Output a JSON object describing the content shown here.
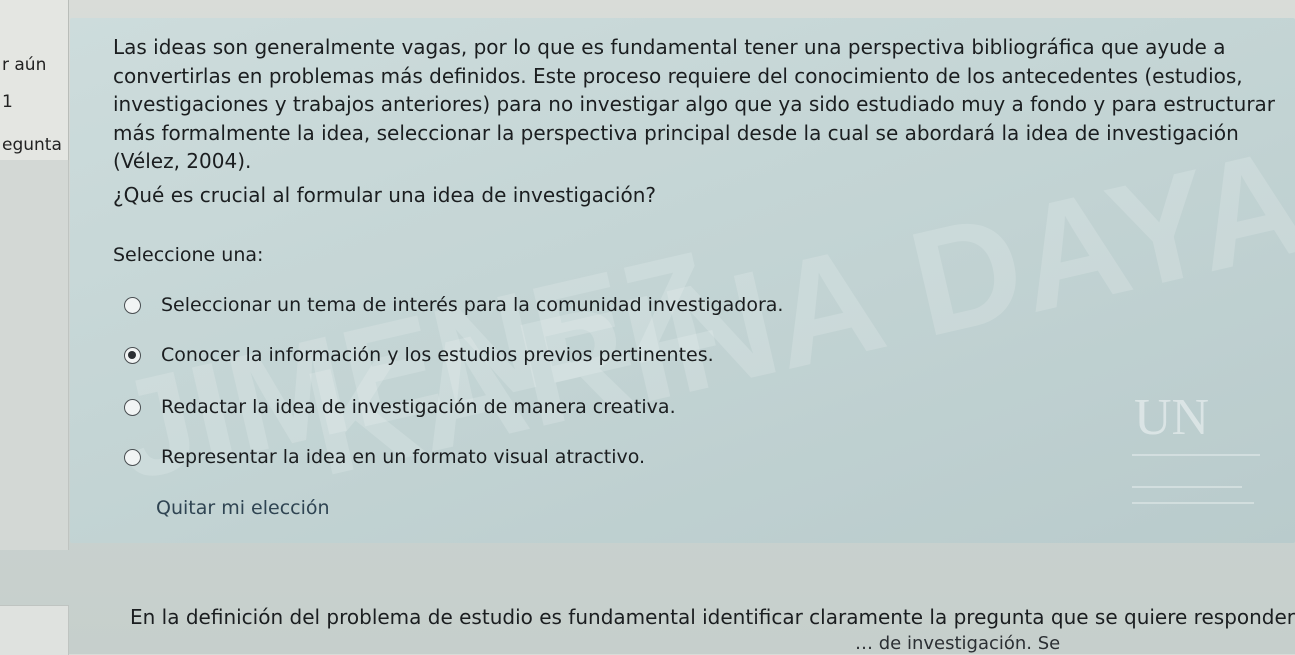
{
  "sidebar": {
    "lines": [
      "r aún",
      "1",
      "egunta"
    ]
  },
  "question": {
    "intro": "Las ideas son generalmente vagas, por lo que es fundamental tener una perspectiva bibliográfica que ayude a convertirlas en problemas más definidos. Este proceso requiere del conocimiento de los antecedentes (estudios, investigaciones y trabajos anteriores) para no investigar algo que ya sido estudiado muy a fondo y para estructurar más formalmente la idea, seleccionar la perspectiva principal desde la cual se abordará la idea de investigación (Vélez, 2004).",
    "text": "¿Qué es crucial al formular una idea de investigación?",
    "prompt": "Seleccione una:",
    "options": [
      {
        "label": "Seleccionar un tema de interés para la comunidad investigadora.",
        "selected": false
      },
      {
        "label": "Conocer la información y los estudios previos pertinentes.",
        "selected": true
      },
      {
        "label": "Redactar la idea de investigación de manera creativa.",
        "selected": false
      },
      {
        "label": "Representar la idea en un formato visual atractivo.",
        "selected": false
      }
    ],
    "clear_label": "Quitar mi elección"
  },
  "watermark": {
    "line1": "KARINA DAYANA MARTINEZ",
    "line2": "JIMENEZ"
  },
  "logo": {
    "text": "UN"
  },
  "next_question": {
    "text": "En la definición del problema de estudio es fundamental identificar claramente la pregunta que se quiere responder o el",
    "text_partial": "… de investigación. Se"
  }
}
